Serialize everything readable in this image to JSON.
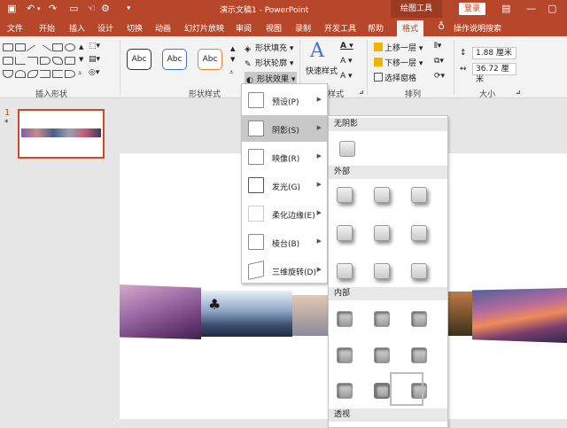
{
  "titlebar": {
    "title": "演示文稿1 - PowerPoint",
    "context_tab": "绘图工具",
    "login": "登录",
    "icons": [
      "save-icon",
      "undo-icon",
      "redo-icon",
      "present-icon",
      "touch-icon",
      "customize-icon"
    ]
  },
  "tabs": [
    "文件",
    "开始",
    "插入",
    "设计",
    "切换",
    "动画",
    "幻灯片放映",
    "审阅",
    "视图",
    "录制",
    "开发工具",
    "帮助",
    "格式",
    "操作说明搜索"
  ],
  "active_tab": "格式",
  "ribbon": {
    "group_insert_shapes": "插入形状",
    "group_shape_styles": "形状样式",
    "group_arrange": "排列",
    "group_size": "大小",
    "style_samples": [
      "Abc",
      "Abc",
      "Abc"
    ],
    "shape_fill": "形状填充",
    "shape_outline": "形状轮廓",
    "shape_effects": "形状效果",
    "quick_styles": "快速样式",
    "art_styles_group": "样式",
    "bring_forward": "上移一层",
    "send_backward": "下移一层",
    "selection_pane": "选择窗格",
    "height": "1.88 厘米",
    "width": "36.72 厘米"
  },
  "slide_number": "1",
  "effects_menu": [
    "预设(P)",
    "阴影(S)",
    "映像(R)",
    "发光(G)",
    "柔化边缘(E)",
    "棱台(B)",
    "三维旋转(D)"
  ],
  "effects_selected_index": 1,
  "shadow_menu": {
    "no_shadow": "无阴影",
    "outer": "外部",
    "inner": "内部",
    "perspective": "透视"
  },
  "colors": {
    "brand": "#b7472a",
    "thumb_border": "#d24726"
  }
}
